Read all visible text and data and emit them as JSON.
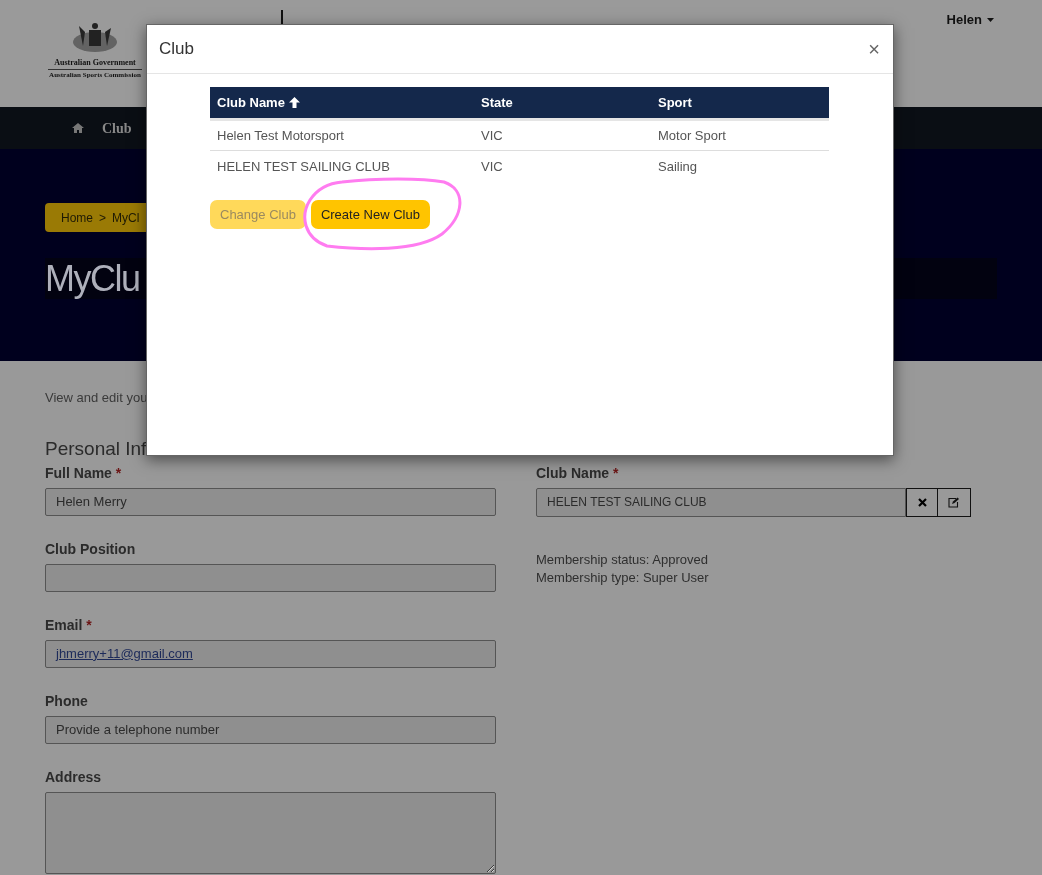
{
  "header": {
    "logo_lines": [
      "Australian Government",
      "Australian Sports Commission"
    ],
    "user_menu": "Helen"
  },
  "nav": {
    "label": "Club"
  },
  "hero": {
    "breadcrumb": [
      "Home",
      "MyCl"
    ],
    "separator": ">",
    "title": "MyClu"
  },
  "intro": "View and edit you",
  "section_title": "Personal Inf",
  "required_mark": "*",
  "left_fields": [
    {
      "kind": "input",
      "label": "Full Name",
      "required": true,
      "value": "Helen Merry"
    },
    {
      "kind": "input",
      "label": "Club Position",
      "required": false
    },
    {
      "kind": "link",
      "label": "Email",
      "required": true,
      "value": "jhmerry+11@gmail.com"
    },
    {
      "kind": "input",
      "label": "Phone",
      "required": false,
      "placeholder": "Provide a telephone number"
    },
    {
      "kind": "textarea",
      "label": "Address",
      "required": false
    }
  ],
  "club_field": {
    "label": "Club Name",
    "required": true,
    "value": "HELEN TEST SAILING CLUB"
  },
  "membership": [
    "Membership status: Approved",
    "Membership type: Super User"
  ],
  "modal": {
    "title": "Club",
    "close": "×",
    "columns": [
      {
        "label": "Club Name",
        "sorted": true
      },
      {
        "label": "State",
        "sorted": false
      },
      {
        "label": "Sport",
        "sorted": false
      }
    ],
    "rows": [
      [
        "Helen Test Motorsport",
        "VIC",
        "Motor Sport"
      ],
      [
        "HELEN TEST SAILING CLUB",
        "VIC",
        "Sailing"
      ]
    ],
    "buttons": [
      {
        "label": "Change Club",
        "disabled": true,
        "highlighted": false
      },
      {
        "label": "Create New Club",
        "disabled": false,
        "highlighted": true
      }
    ]
  }
}
